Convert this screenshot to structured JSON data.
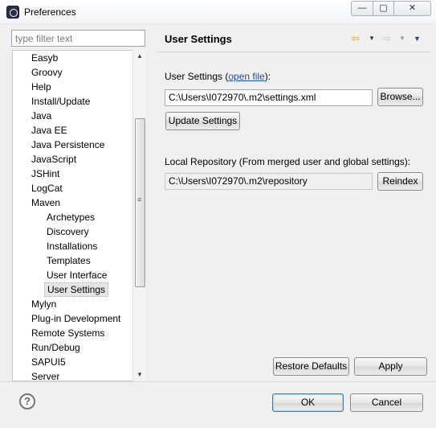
{
  "window": {
    "title": "Preferences",
    "buttons": {
      "minimize": "—",
      "maximize": "▢",
      "close": "✕"
    }
  },
  "filter": {
    "placeholder": "type filter text",
    "value": ""
  },
  "tree": {
    "items": [
      {
        "label": "Easyb",
        "level": 0
      },
      {
        "label": "Groovy",
        "level": 0
      },
      {
        "label": "Help",
        "level": 0
      },
      {
        "label": "Install/Update",
        "level": 0
      },
      {
        "label": "Java",
        "level": 0
      },
      {
        "label": "Java EE",
        "level": 0
      },
      {
        "label": "Java Persistence",
        "level": 0
      },
      {
        "label": "JavaScript",
        "level": 0
      },
      {
        "label": "JSHint",
        "level": 0
      },
      {
        "label": "LogCat",
        "level": 0
      },
      {
        "label": "Maven",
        "level": 0
      },
      {
        "label": "Archetypes",
        "level": 1
      },
      {
        "label": "Discovery",
        "level": 1
      },
      {
        "label": "Installations",
        "level": 1
      },
      {
        "label": "Templates",
        "level": 1
      },
      {
        "label": "User Interface",
        "level": 1
      },
      {
        "label": "User Settings",
        "level": 1,
        "selected": true
      },
      {
        "label": "Mylyn",
        "level": 0
      },
      {
        "label": "Plug-in Development",
        "level": 0
      },
      {
        "label": "Remote Systems",
        "level": 0
      },
      {
        "label": "Run/Debug",
        "level": 0
      },
      {
        "label": "SAPUI5",
        "level": 0
      },
      {
        "label": "Server",
        "level": 0
      }
    ]
  },
  "icons": {
    "back": "⇦",
    "forward": "⇨",
    "dropdown": "▼",
    "scroll_up": "▲",
    "scroll_down": "▼",
    "help": "?"
  },
  "page": {
    "title": "User Settings",
    "user_settings_label": "User Settings (",
    "open_file_link": "open file",
    "user_settings_label_end": "):",
    "user_settings_value": "C:\\Users\\I072970\\.m2\\settings.xml",
    "browse_button": "Browse...",
    "update_settings_button": "Update Settings",
    "local_repo_label": "Local Repository (From merged user and global settings):",
    "local_repo_value": "C:\\Users\\I072970\\.m2\\repository",
    "reindex_button": "Reindex",
    "restore_defaults_button": "Restore Defaults",
    "apply_button": "Apply"
  },
  "footer": {
    "ok_button": "OK",
    "cancel_button": "Cancel"
  }
}
